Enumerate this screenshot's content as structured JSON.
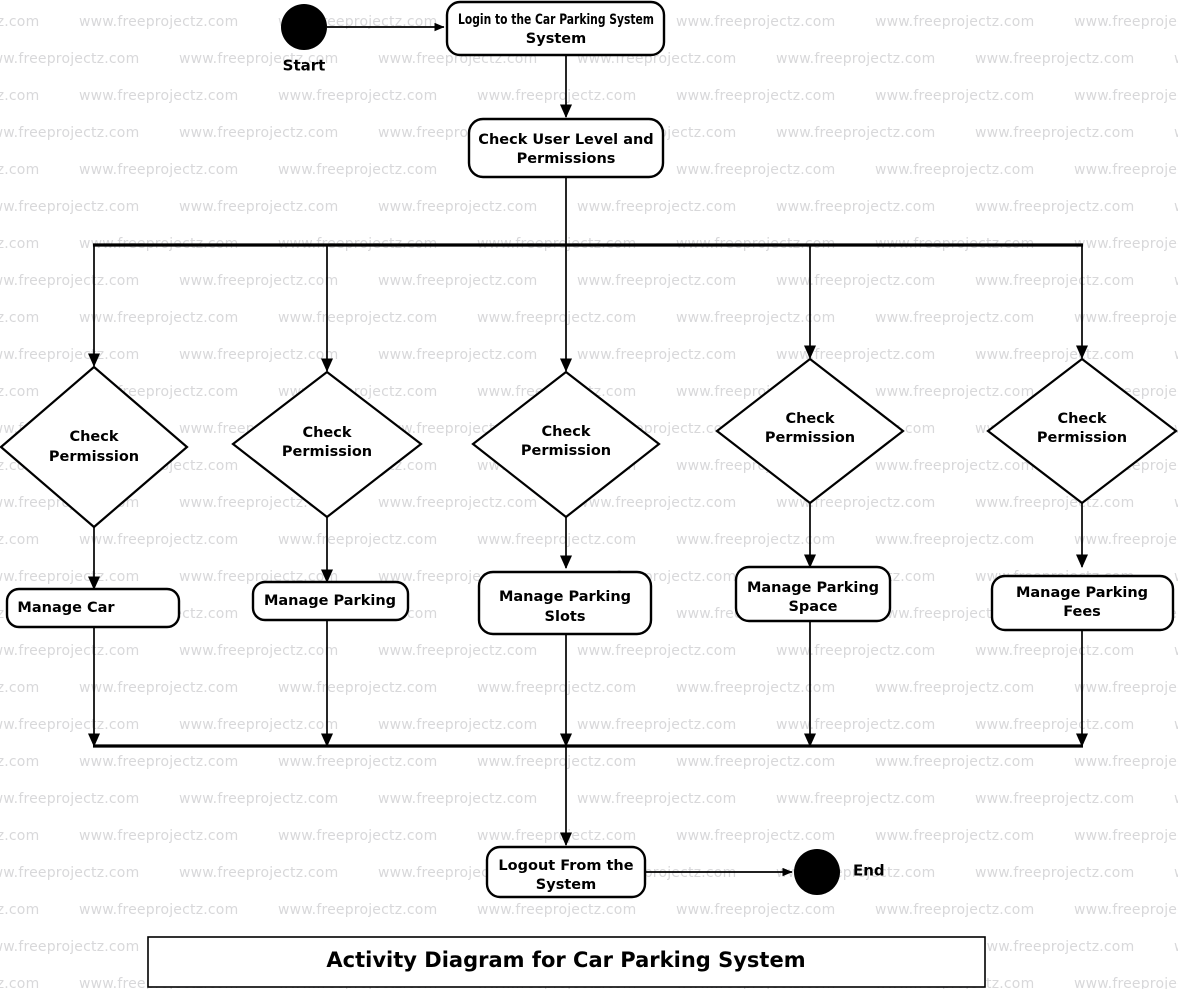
{
  "diagram": {
    "title": "Activity Diagram for Car Parking System",
    "type": "uml-activity-diagram",
    "start_label": "Start",
    "end_label": "End",
    "initial_activities": [
      {
        "id": "login",
        "label": "Login to the Car Parking System"
      },
      {
        "id": "check_user",
        "label": "Check User Level and Permissions"
      }
    ],
    "branches": [
      {
        "id": "branch1",
        "decision": "Check Permission",
        "activity": "Manage Car"
      },
      {
        "id": "branch2",
        "decision": "Check Permission",
        "activity": "Manage Parking"
      },
      {
        "id": "branch3",
        "decision": "Check Permission",
        "activity": "Manage Parking Slots"
      },
      {
        "id": "branch4",
        "decision": "Check Permission",
        "activity": "Manage Parking Space"
      },
      {
        "id": "branch5",
        "decision": "Check Permission",
        "activity": "Manage Parking Fees"
      }
    ],
    "final_activity": {
      "id": "logout",
      "label": "Logout From the System"
    },
    "decision_line1": "Check",
    "decision_line2": "Permission",
    "colors": {
      "stroke": "#000000",
      "fill": "#ffffff",
      "watermark": "#d8d8da"
    }
  },
  "watermark": {
    "text": "www.freeprojectz.com"
  }
}
